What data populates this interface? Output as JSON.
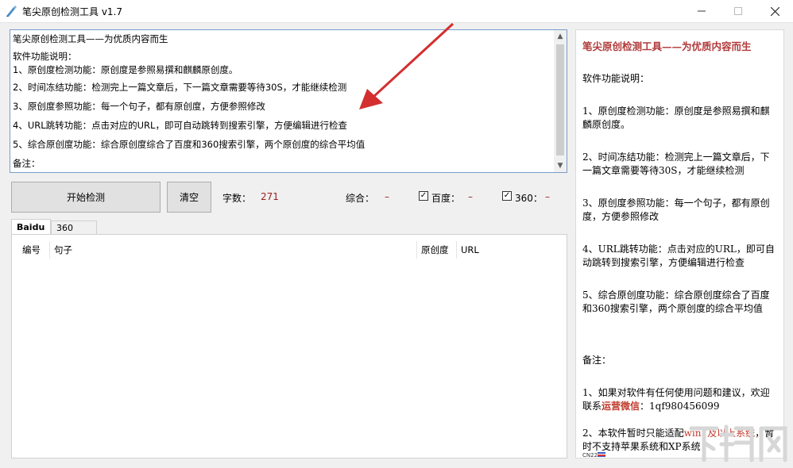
{
  "window": {
    "title": "笔尖原创检测工具 v1.7",
    "icon": "pen-nib-icon"
  },
  "editor": {
    "lines": [
      "笔尖原创检测工具——为优质内容而生",
      "软件功能说明：",
      "1、原创度检测功能：原创度是参照易撰和麒麟原创度。",
      "2、时间冻结功能：检测完上一篇文章后，下一篇文章需要等待30S，才能继续检测",
      "3、原创度参照功能：每一个句子，都有原创度，方便参照修改",
      "4、URL跳转功能：点击对应的URL，即可自动跳转到搜索引擎，方便编辑进行检查",
      "5、综合原创度功能：综合原创度综合了百度和360搜索引擎，两个原创度的综合平均值",
      "备注："
    ]
  },
  "toolbar": {
    "start_label": "开始检测",
    "clear_label": "清空",
    "char_count_label": "字数：",
    "char_count_value": "271",
    "composite_label": "综合：",
    "composite_value": "–",
    "baidu_checked": true,
    "baidu_label": "百度：",
    "baidu_value": "–",
    "s360_checked": true,
    "s360_label": "360：",
    "s360_value": "–"
  },
  "tabs": [
    {
      "label": "Baidu",
      "active": true
    },
    {
      "label": "360",
      "active": false
    }
  ],
  "table": {
    "columns": [
      "编号",
      "句子",
      "原创度",
      "URL"
    ],
    "rows": []
  },
  "side_panel": {
    "title": "笔尖原创检测工具——为优质内容而生",
    "heading": "软件功能说明：",
    "items": [
      "1、原创度检测功能：原创度是参照易撰和麒麟原创度。",
      "2、时间冻结功能：检测完上一篇文章后，下一篇文章需要等待30S，才能继续检测",
      "3、原创度参照功能：每一个句子，都有原创度，方便参照修改",
      "4、URL跳转功能：点击对应的URL，即可自动跳转到搜索引擎，方便编辑进行检查",
      "5、综合原创度功能：综合原创度综合了百度和360搜索引擎，两个原创度的综合平均值"
    ],
    "note_heading": "备注：",
    "note1_prefix": "1、如果对软件有任何使用问题和建议，欢迎联系",
    "note1_highlight": "运营微信",
    "note1_suffix": "：1qf980456099",
    "note2_prefix": "2、本软件暂时只能适配",
    "note2_highlight": "win7及以上系统",
    "note2_suffix": "，暂时不支持苹果系统和XP系统"
  },
  "status": {
    "lang_badge": "CN22"
  },
  "colors": {
    "accent_red": "#c0392b",
    "value_red": "#9a1e1e",
    "arrow_red": "#d32f2f"
  }
}
